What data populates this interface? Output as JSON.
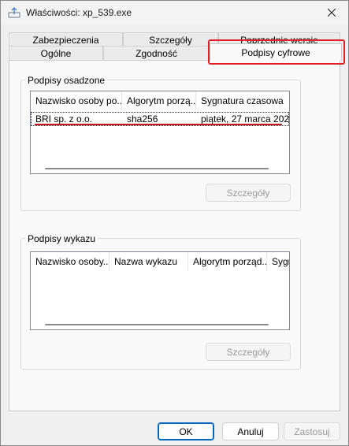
{
  "window": {
    "title": "Właściwości: xp_539.exe",
    "close_label": "✕"
  },
  "tabs_row_back": [
    {
      "label": "Zabezpieczenia"
    },
    {
      "label": "Szczegóły"
    },
    {
      "label": "Poprzednie wersje"
    }
  ],
  "tabs_row_front": [
    {
      "label": "Ogólne"
    },
    {
      "label": "Zgodność"
    },
    {
      "label": "Podpisy cyfrowe"
    }
  ],
  "embedded": {
    "group_label": "Podpisy osadzone",
    "columns": [
      "Nazwisko osoby po...",
      "Algorytm porzą...",
      "Sygnatura czasowa"
    ],
    "rows": [
      [
        "BRI sp. z o.o.",
        "sha256",
        "piątek, 27 marca 202..."
      ]
    ],
    "details_button": "Szczegóły"
  },
  "catalog": {
    "group_label": "Podpisy wykazu",
    "columns": [
      "Nazwisko osoby...",
      "Nazwa wykazu",
      "Algorytm porząd...",
      "Sygn"
    ],
    "details_button": "Szczegóły"
  },
  "buttons": {
    "ok": "OK",
    "cancel": "Anuluj",
    "apply": "Zastosuj"
  },
  "colors": {
    "highlight": "#e0202a",
    "underline": "#c8141e",
    "accent": "#0067c0"
  }
}
